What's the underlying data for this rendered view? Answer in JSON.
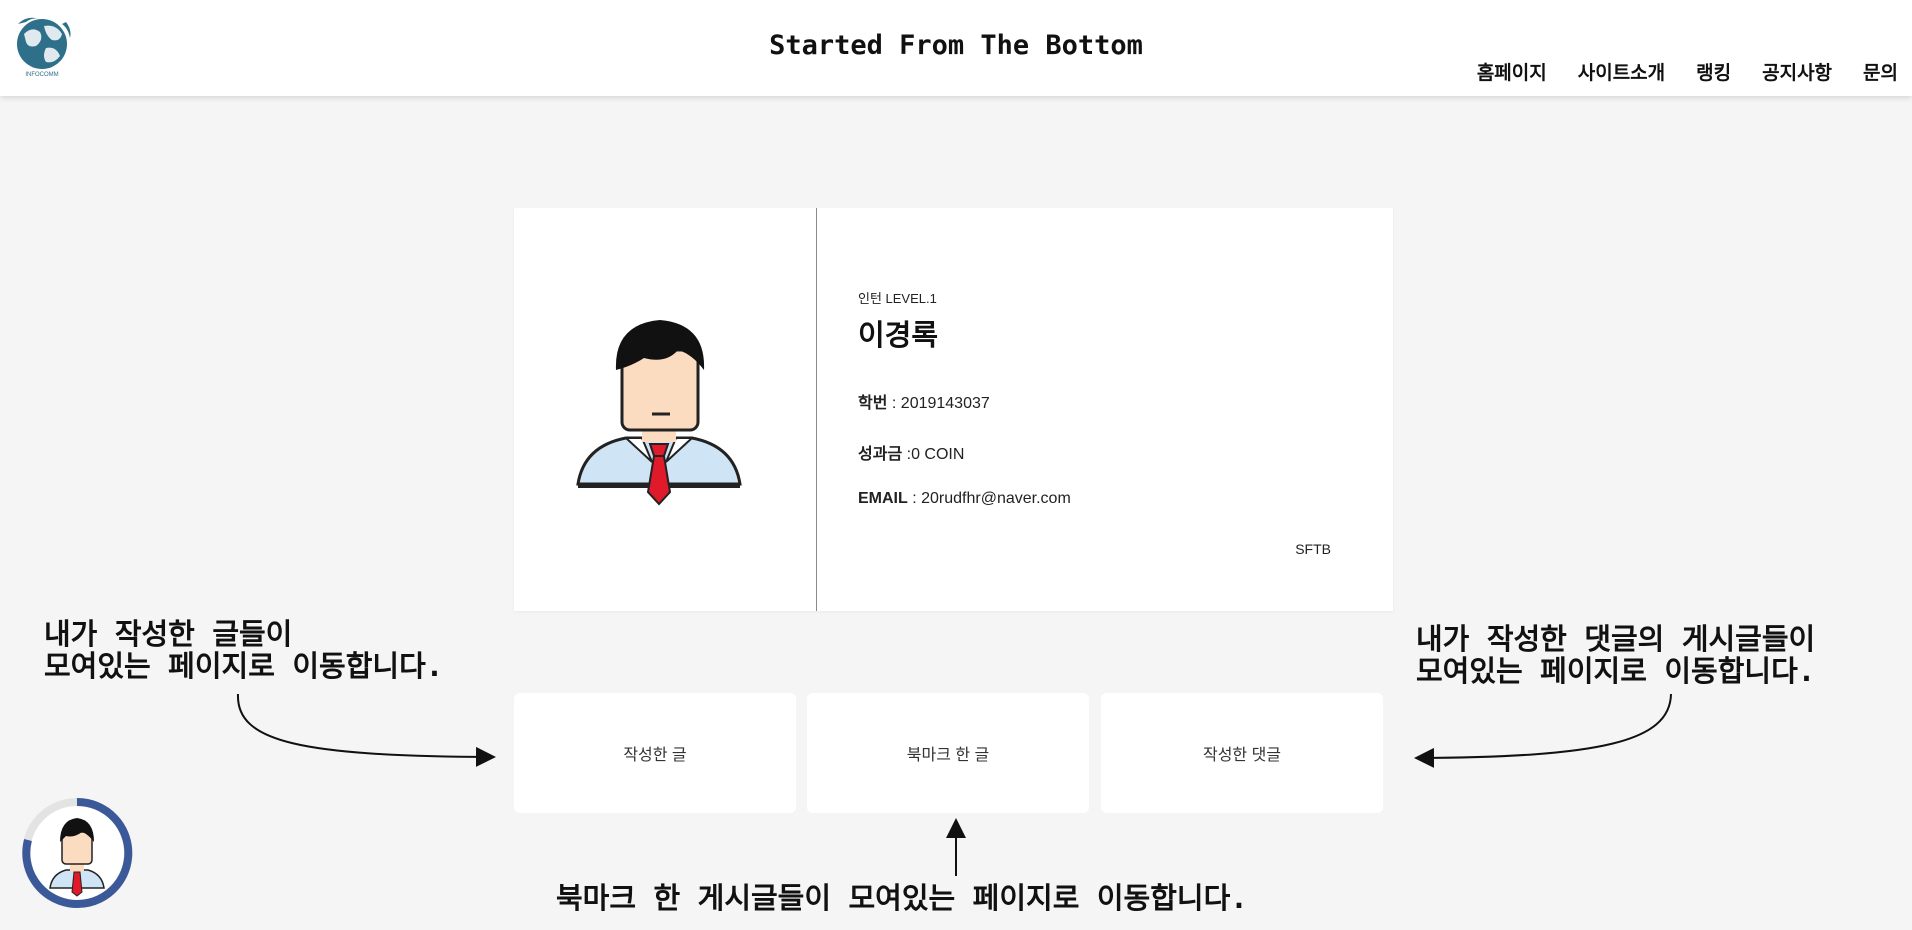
{
  "header": {
    "logo_text": "INFOCOMM",
    "title": "Started From The Bottom",
    "nav": [
      "홈페이지",
      "사이트소개",
      "랭킹",
      "공지사항",
      "문의"
    ]
  },
  "profile": {
    "level": "인턴 LEVEL.1",
    "name": "이경록",
    "id_label": "학번",
    "id_value": " : 2019143037",
    "coin_label": "성과금",
    "coin_value": " :0 COIN",
    "email_label": "EMAIL",
    "email_value": " : 20rudfhr@naver.com",
    "tag": "SFTB"
  },
  "actions": {
    "my_posts": "작성한 글",
    "bookmarks": "북마크 한 글",
    "my_comments": "작성한 댓글"
  },
  "annotations": {
    "left_line1": "내가 작성한 글들이",
    "left_line2": "모여있는 페이지로 이동합니다.",
    "right_line1": "내가 작성한 댓글의 게시글들이",
    "right_line2": "모여있는 페이지로 이동합니다.",
    "bottom": "북마크 한 게시글들이 모여있는 페이지로 이동합니다."
  },
  "colors": {
    "background": "#f5f5f5",
    "card": "#ffffff",
    "progress_ring": "#3b5998",
    "tie": "#e0192b"
  }
}
